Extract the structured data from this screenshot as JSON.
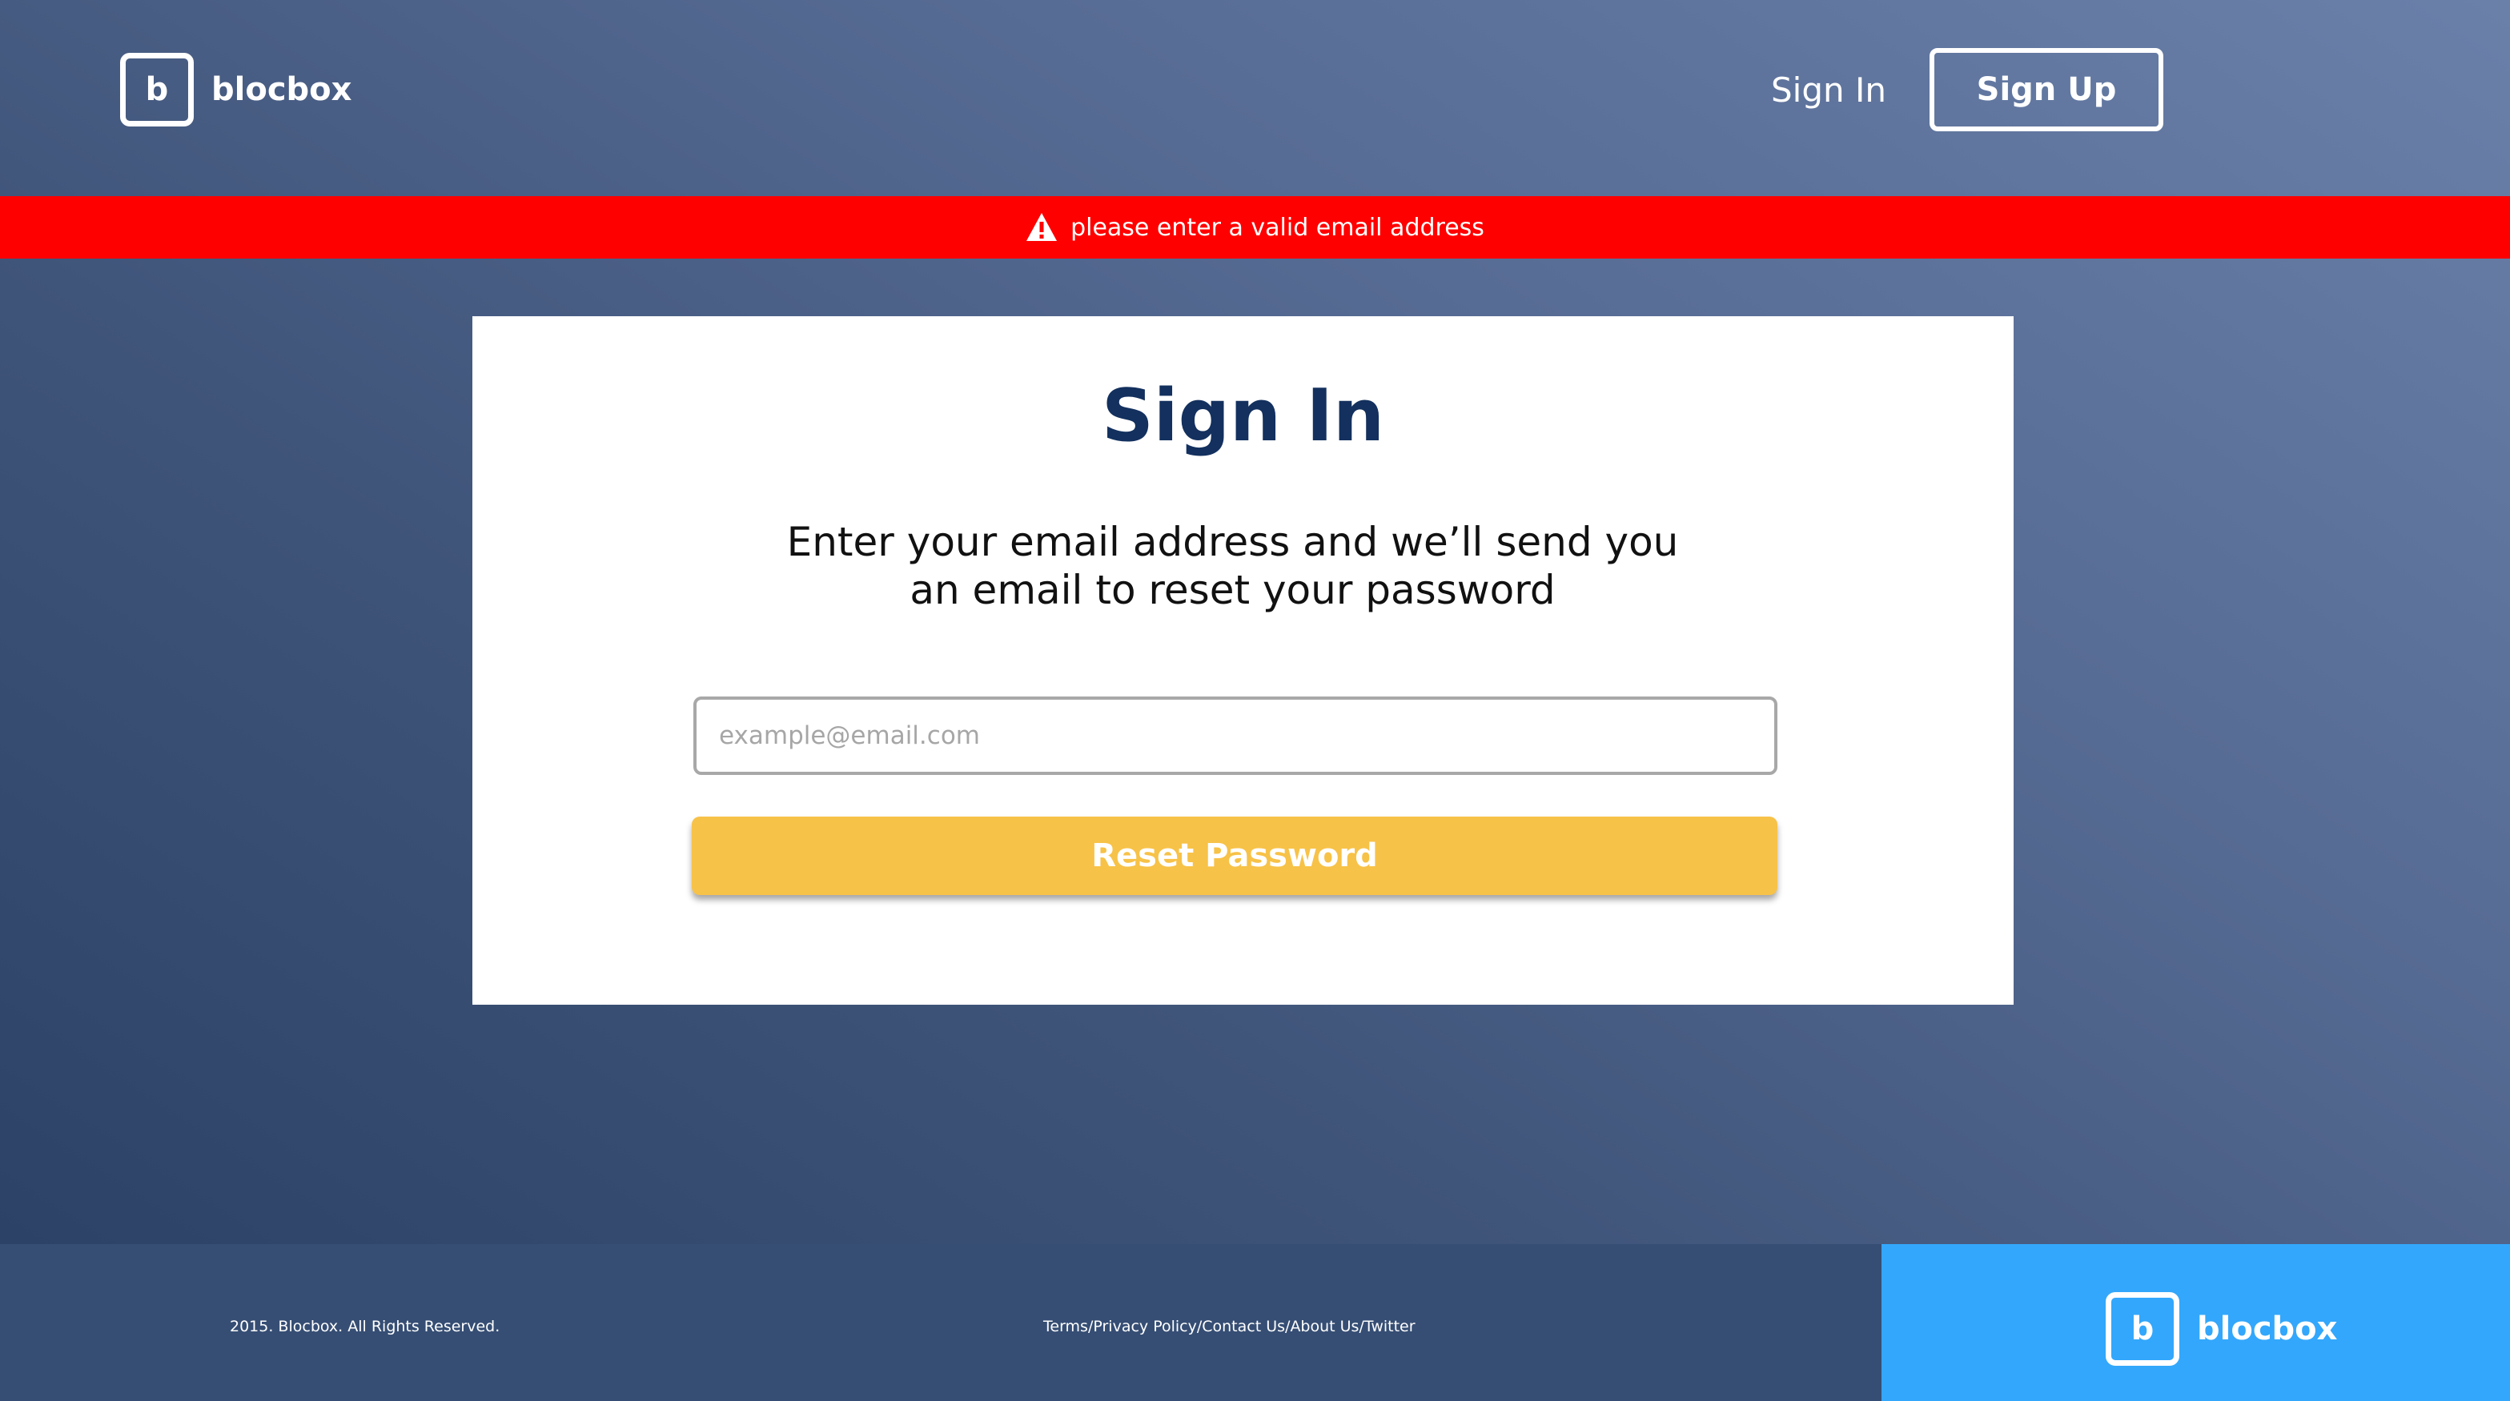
{
  "header": {
    "logo_letter": "b",
    "logo_text": "blocbox",
    "signin_label": "Sign In",
    "signup_label": "Sign Up"
  },
  "alert": {
    "icon": "warning-icon",
    "message": "please enter a valid email address",
    "color": "#ff0000"
  },
  "card": {
    "title": "Sign In",
    "description": "Enter your email address and we’ll send you an email to reset your password",
    "email_placeholder": "example@email.com",
    "email_value": "",
    "reset_button_label": "Reset Password"
  },
  "footer": {
    "copyright": "2015. Blocbox. All Rights Reserved.",
    "links": [
      "Terms",
      "Privacy Policy",
      "Contact Us",
      "About Us",
      "Twitter"
    ],
    "separator": "/",
    "logo_letter": "b",
    "logo_text": "blocbox"
  },
  "colors": {
    "title": "#13305e",
    "button": "#f7c248",
    "footer_brand": "#33a7fb",
    "footer": "#364e74"
  }
}
